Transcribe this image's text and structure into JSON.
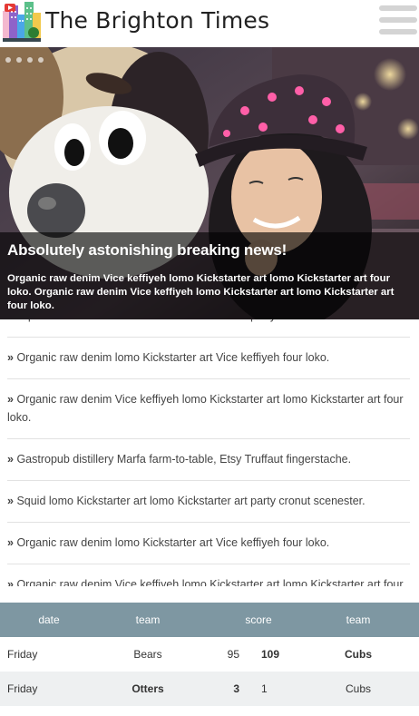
{
  "header": {
    "site_title": "The Brighton Times",
    "logo_icon": "city-newspaper-logo-icon",
    "menu_icon": "hamburger-menu-icon"
  },
  "hero": {
    "image": "photo-woman-with-plush-dog-mascot",
    "title": "Absolutely astonishing breaking news!",
    "text": "Organic raw denim Vice keffiyeh lomo Kickstarter art lomo Kickstarter art four loko. Organic raw denim Vice keffiyeh lomo Kickstarter art lomo Kickstarter art four loko.",
    "slide_count": 4
  },
  "news": {
    "bullet": "»",
    "items": [
      "Squid lomo Kickstarter art lomo Kickstarter art party cronut scenester.",
      "Organic raw denim lomo Kickstarter art Vice keffiyeh four loko.",
      "Organic raw denim Vice keffiyeh lomo Kickstarter art lomo Kickstarter art four loko.",
      "Gastropub distillery Marfa farm-to-table, Etsy Truffaut fingerstache.",
      "Squid lomo Kickstarter art lomo Kickstarter art party cronut scenester.",
      "Organic raw denim lomo Kickstarter art Vice keffiyeh four loko.",
      "Organic raw denim Vice keffiyeh lomo Kickstarter art lomo Kickstarter art four loko."
    ]
  },
  "scores": {
    "headers": {
      "date": "date",
      "team1": "team",
      "score": "score",
      "team2": "team"
    },
    "rows": [
      {
        "date": "Friday",
        "team1": "Bears",
        "score1": "95",
        "score2": "109",
        "team2": "Cubs",
        "winner": 2
      },
      {
        "date": "Friday",
        "team1": "Otters",
        "score1": "3",
        "score2": "1",
        "team2": "Cubs",
        "winner": 1
      }
    ]
  },
  "colors": {
    "table_header": "#7e97a2",
    "caption_overlay": "rgba(0,0,0,0.62)",
    "row_alt": "#eef0f1"
  }
}
